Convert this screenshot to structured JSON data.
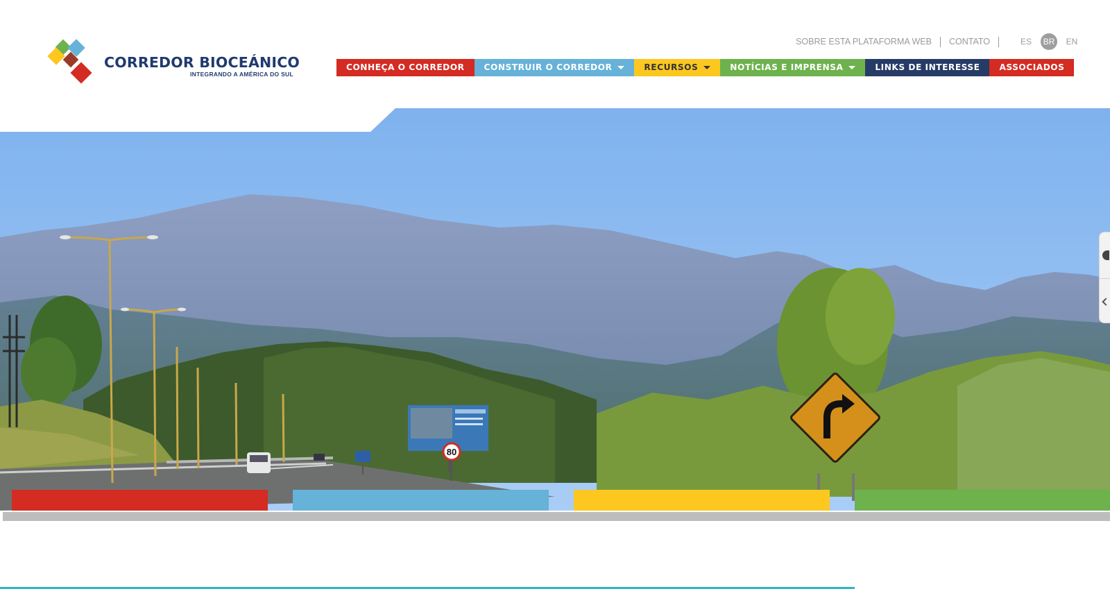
{
  "brand": {
    "title": "CORREDOR BIOCEÁNICO",
    "subtitle": "INTEGRANDO A AMÉRICA DO SUL",
    "colors": [
      "#d42b23",
      "#66b2d8",
      "#fcc820",
      "#6db24d",
      "#263b66"
    ]
  },
  "topbar": {
    "links": [
      "SOBRE ESTA PLATAFORMA WEB",
      "CONTATO"
    ],
    "languages": [
      "ES",
      "BR",
      "EN"
    ],
    "active_language": "BR"
  },
  "nav": {
    "items": [
      {
        "label": "CONHEÇA O CORREDOR",
        "dropdown": false,
        "color": "#d42b23"
      },
      {
        "label": "CONSTRUIR O CORREDOR",
        "dropdown": true,
        "color": "#66b2d8"
      },
      {
        "label": "RECURSOS",
        "dropdown": true,
        "color": "#fcc820"
      },
      {
        "label": "NOTÍCIAS E IMPRENSA",
        "dropdown": true,
        "color": "#6db24d"
      },
      {
        "label": "LINKS DE INTERESSE",
        "dropdown": false,
        "color": "#263b66"
      },
      {
        "label": "ASSOCIADOS",
        "dropdown": false,
        "color": "#d42b23"
      }
    ]
  },
  "hero": {
    "sign_speed_limit": "80",
    "tab_colors": [
      "#d42b23",
      "#66b2d8",
      "#fcc820",
      "#6db24d"
    ]
  }
}
